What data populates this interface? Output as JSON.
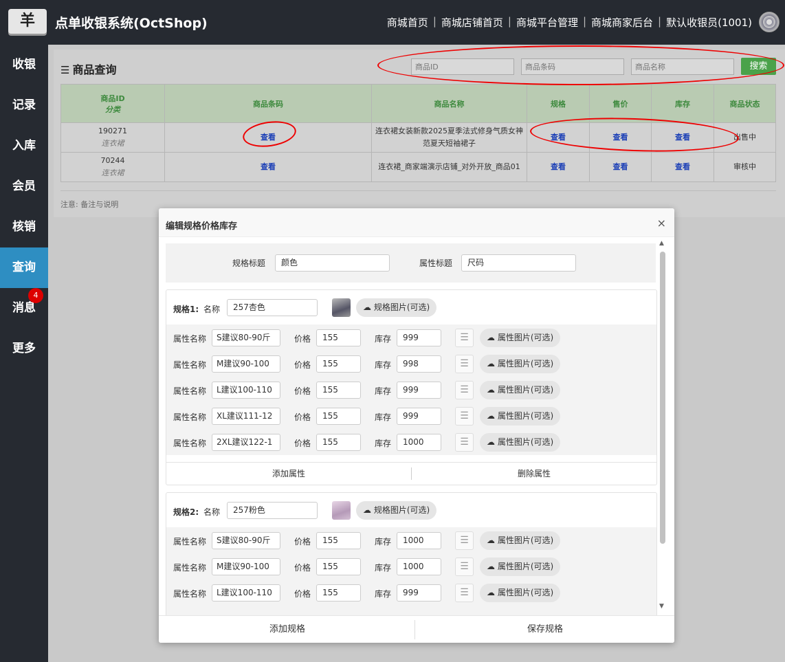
{
  "app": {
    "logo_glyph": "羊",
    "title": "点单收银系统(OctShop)",
    "nav": [
      "商城首页",
      "商城店铺首页",
      "商城平台管理",
      "商城商家后台",
      "默认收银员(1001)"
    ],
    "nav_sep": "|"
  },
  "sidebar": {
    "items": [
      {
        "label": "收银"
      },
      {
        "label": "记录"
      },
      {
        "label": "入库"
      },
      {
        "label": "会员"
      },
      {
        "label": "核销"
      },
      {
        "label": "查询",
        "active": true
      },
      {
        "label": "消息",
        "badge": "4"
      },
      {
        "label": "更多"
      }
    ]
  },
  "query": {
    "title": "商品查询",
    "placeholders": {
      "id": "商品ID",
      "barcode": "商品条码",
      "name": "商品名称"
    },
    "search_label": "搜索",
    "columns": {
      "id": "商品ID",
      "category": "分类",
      "barcode": "商品条码",
      "name": "商品名称",
      "spec": "规格",
      "price": "售价",
      "stock": "库存",
      "status": "商品状态"
    },
    "rows": [
      {
        "id": "190271",
        "category": "连衣裙",
        "barcode": "查看",
        "name": "连衣裙女装新款2025夏季法式修身气质女神范夏天短袖裙子",
        "spec": "查看",
        "price": "查看",
        "stock": "查看",
        "status": "出售中"
      },
      {
        "id": "70244",
        "category": "连衣裙",
        "barcode": "查看",
        "name": "连衣裙_商家端演示店铺_对外开放_商品01",
        "spec": "查看",
        "price": "查看",
        "stock": "查看",
        "status": "审核中"
      }
    ],
    "note": "注意: 备注与说明"
  },
  "modal": {
    "title": "编辑规格价格库存",
    "close": "×",
    "spec_title_label": "规格标题",
    "spec_title_value": "颜色",
    "attr_title_label": "属性标题",
    "attr_title_value": "尺码",
    "labels": {
      "name": "名称",
      "attr_name": "属性名称",
      "price": "价格",
      "stock": "库存",
      "spec_img": "规格图片(可选)",
      "attr_img": "属性图片(可选)",
      "add_attr": "添加属性",
      "del_attr": "删除属性"
    },
    "specs": [
      {
        "label": "规格1:",
        "name": "257杏色",
        "attrs": [
          {
            "name": "S建议80-90斤",
            "price": "155",
            "stock": "999"
          },
          {
            "name": "M建议90-100",
            "price": "155",
            "stock": "998"
          },
          {
            "name": "L建议100-110",
            "price": "155",
            "stock": "999"
          },
          {
            "name": "XL建议111-12",
            "price": "155",
            "stock": "999"
          },
          {
            "name": "2XL建议122-1",
            "price": "155",
            "stock": "1000"
          }
        ]
      },
      {
        "label": "规格2:",
        "name": "257粉色",
        "attrs": [
          {
            "name": "S建议80-90斤",
            "price": "155",
            "stock": "1000"
          },
          {
            "name": "M建议90-100",
            "price": "155",
            "stock": "1000"
          },
          {
            "name": "L建议100-110",
            "price": "155",
            "stock": "999"
          }
        ]
      }
    ],
    "footer": {
      "add_spec": "添加规格",
      "save_spec": "保存规格"
    }
  }
}
